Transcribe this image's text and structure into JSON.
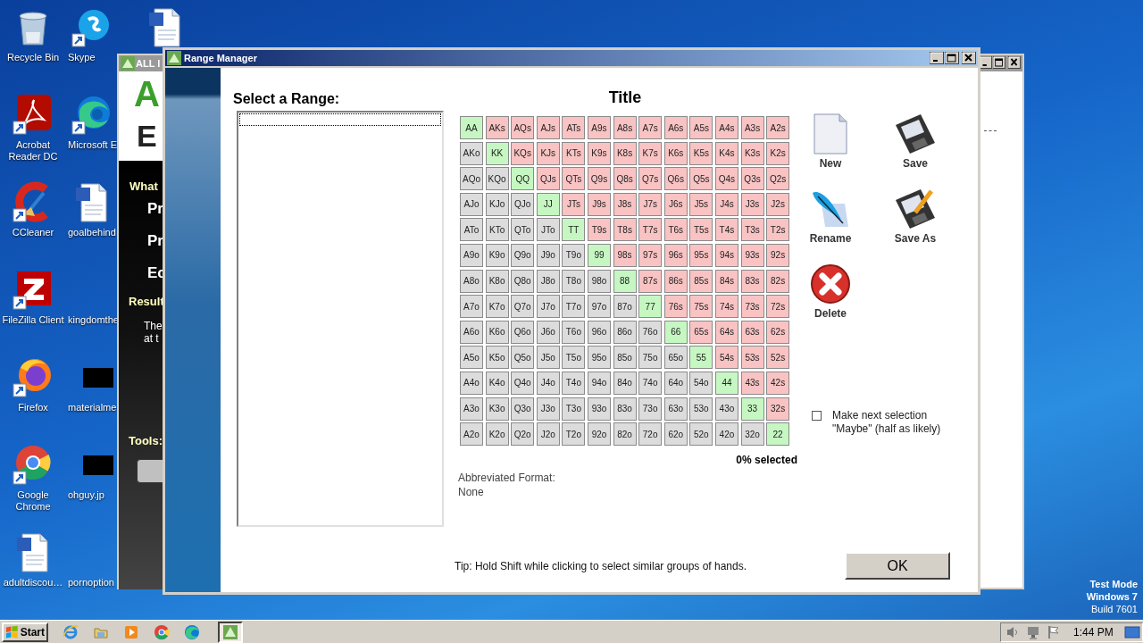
{
  "desktop": {
    "icons": [
      {
        "label": "Recycle Bin",
        "kind": "recycle",
        "shortcut": false
      },
      {
        "label": "Acrobat\nReader DC",
        "kind": "acrobat",
        "shortcut": true
      },
      {
        "label": "CCleaner",
        "kind": "ccleaner",
        "shortcut": true
      },
      {
        "label": "FileZilla Client",
        "kind": "filezilla",
        "shortcut": true
      },
      {
        "label": "Firefox",
        "kind": "firefox",
        "shortcut": true
      },
      {
        "label": "Google\nChrome",
        "kind": "chrome",
        "shortcut": true
      },
      {
        "label": "adultdiscou…",
        "kind": "word",
        "shortcut": false
      },
      {
        "label": "Skype",
        "kind": "skype",
        "shortcut": true
      },
      {
        "label": "Microsoft E",
        "kind": "edge",
        "shortcut": true
      },
      {
        "label": "goalbehind",
        "kind": "word",
        "shortcut": false
      },
      {
        "label": "kingdomthe",
        "kind": "blank",
        "shortcut": false
      },
      {
        "label": "materialme",
        "kind": "redacted",
        "shortcut": false
      },
      {
        "label": "ohguy.jp",
        "kind": "redacted",
        "shortcut": false
      },
      {
        "label": "pornoption",
        "kind": "blank",
        "shortcut": false
      },
      {
        "kind": "word",
        "shortcut": false
      }
    ],
    "os_notice": [
      "Test Mode",
      "Windows 7",
      "Build 7601"
    ]
  },
  "back_window": {
    "title": "ALL I",
    "logo": [
      "A",
      "E"
    ],
    "texts": [
      {
        "text": "What",
        "kind": "heading"
      },
      {
        "text": "Pr",
        "kind": "item"
      },
      {
        "text": "Pr",
        "kind": "item"
      },
      {
        "text": "Ec",
        "kind": "item"
      },
      {
        "text": "Result",
        "kind": "heading"
      },
      {
        "text": "The\nat t",
        "kind": "body"
      },
      {
        "text": "Tools:",
        "kind": "heading"
      }
    ]
  },
  "window": {
    "title": "Range Manager",
    "range_label": "Select a Range:",
    "grid_title": "Title",
    "grid": [
      [
        {
          "label": "AA",
          "kind": "pair"
        },
        {
          "label": "AKs",
          "kind": "suited"
        },
        {
          "label": "AQs",
          "kind": "suited"
        },
        {
          "label": "AJs",
          "kind": "suited"
        },
        {
          "label": "ATs",
          "kind": "suited"
        },
        {
          "label": "A9s",
          "kind": "suited"
        },
        {
          "label": "A8s",
          "kind": "suited"
        },
        {
          "label": "A7s",
          "kind": "suited"
        },
        {
          "label": "A6s",
          "kind": "suited"
        },
        {
          "label": "A5s",
          "kind": "suited"
        },
        {
          "label": "A4s",
          "kind": "suited"
        },
        {
          "label": "A3s",
          "kind": "suited"
        },
        {
          "label": "A2s",
          "kind": "suited"
        }
      ],
      [
        {
          "label": "AKo",
          "kind": "offsuit"
        },
        {
          "label": "KK",
          "kind": "pair"
        },
        {
          "label": "KQs",
          "kind": "suited"
        },
        {
          "label": "KJs",
          "kind": "suited"
        },
        {
          "label": "KTs",
          "kind": "suited"
        },
        {
          "label": "K9s",
          "kind": "suited"
        },
        {
          "label": "K8s",
          "kind": "suited"
        },
        {
          "label": "K7s",
          "kind": "suited"
        },
        {
          "label": "K6s",
          "kind": "suited"
        },
        {
          "label": "K5s",
          "kind": "suited"
        },
        {
          "label": "K4s",
          "kind": "suited"
        },
        {
          "label": "K3s",
          "kind": "suited"
        },
        {
          "label": "K2s",
          "kind": "suited"
        }
      ],
      [
        {
          "label": "AQo",
          "kind": "offsuit"
        },
        {
          "label": "KQo",
          "kind": "offsuit"
        },
        {
          "label": "QQ",
          "kind": "pair"
        },
        {
          "label": "QJs",
          "kind": "suited"
        },
        {
          "label": "QTs",
          "kind": "suited"
        },
        {
          "label": "Q9s",
          "kind": "suited"
        },
        {
          "label": "Q8s",
          "kind": "suited"
        },
        {
          "label": "Q7s",
          "kind": "suited"
        },
        {
          "label": "Q6s",
          "kind": "suited"
        },
        {
          "label": "Q5s",
          "kind": "suited"
        },
        {
          "label": "Q4s",
          "kind": "suited"
        },
        {
          "label": "Q3s",
          "kind": "suited"
        },
        {
          "label": "Q2s",
          "kind": "suited"
        }
      ],
      [
        {
          "label": "AJo",
          "kind": "offsuit"
        },
        {
          "label": "KJo",
          "kind": "offsuit"
        },
        {
          "label": "QJo",
          "kind": "offsuit"
        },
        {
          "label": "JJ",
          "kind": "pair"
        },
        {
          "label": "JTs",
          "kind": "suited"
        },
        {
          "label": "J9s",
          "kind": "suited"
        },
        {
          "label": "J8s",
          "kind": "suited"
        },
        {
          "label": "J7s",
          "kind": "suited"
        },
        {
          "label": "J6s",
          "kind": "suited"
        },
        {
          "label": "J5s",
          "kind": "suited"
        },
        {
          "label": "J4s",
          "kind": "suited"
        },
        {
          "label": "J3s",
          "kind": "suited"
        },
        {
          "label": "J2s",
          "kind": "suited"
        }
      ],
      [
        {
          "label": "ATo",
          "kind": "offsuit"
        },
        {
          "label": "KTo",
          "kind": "offsuit"
        },
        {
          "label": "QTo",
          "kind": "offsuit"
        },
        {
          "label": "JTo",
          "kind": "offsuit"
        },
        {
          "label": "TT",
          "kind": "pair"
        },
        {
          "label": "T9s",
          "kind": "suited"
        },
        {
          "label": "T8s",
          "kind": "suited"
        },
        {
          "label": "T7s",
          "kind": "suited"
        },
        {
          "label": "T6s",
          "kind": "suited"
        },
        {
          "label": "T5s",
          "kind": "suited"
        },
        {
          "label": "T4s",
          "kind": "suited"
        },
        {
          "label": "T3s",
          "kind": "suited"
        },
        {
          "label": "T2s",
          "kind": "suited"
        }
      ],
      [
        {
          "label": "A9o",
          "kind": "offsuit"
        },
        {
          "label": "K9o",
          "kind": "offsuit"
        },
        {
          "label": "Q9o",
          "kind": "offsuit"
        },
        {
          "label": "J9o",
          "kind": "offsuit"
        },
        {
          "label": "T9o",
          "kind": "offsuit"
        },
        {
          "label": "99",
          "kind": "pair"
        },
        {
          "label": "98s",
          "kind": "suited"
        },
        {
          "label": "97s",
          "kind": "suited"
        },
        {
          "label": "96s",
          "kind": "suited"
        },
        {
          "label": "95s",
          "kind": "suited"
        },
        {
          "label": "94s",
          "kind": "suited"
        },
        {
          "label": "93s",
          "kind": "suited"
        },
        {
          "label": "92s",
          "kind": "suited"
        }
      ],
      [
        {
          "label": "A8o",
          "kind": "offsuit"
        },
        {
          "label": "K8o",
          "kind": "offsuit"
        },
        {
          "label": "Q8o",
          "kind": "offsuit"
        },
        {
          "label": "J8o",
          "kind": "offsuit"
        },
        {
          "label": "T8o",
          "kind": "offsuit"
        },
        {
          "label": "98o",
          "kind": "offsuit"
        },
        {
          "label": "88",
          "kind": "pair"
        },
        {
          "label": "87s",
          "kind": "suited"
        },
        {
          "label": "86s",
          "kind": "suited"
        },
        {
          "label": "85s",
          "kind": "suited"
        },
        {
          "label": "84s",
          "kind": "suited"
        },
        {
          "label": "83s",
          "kind": "suited"
        },
        {
          "label": "82s",
          "kind": "suited"
        }
      ],
      [
        {
          "label": "A7o",
          "kind": "offsuit"
        },
        {
          "label": "K7o",
          "kind": "offsuit"
        },
        {
          "label": "Q7o",
          "kind": "offsuit"
        },
        {
          "label": "J7o",
          "kind": "offsuit"
        },
        {
          "label": "T7o",
          "kind": "offsuit"
        },
        {
          "label": "97o",
          "kind": "offsuit"
        },
        {
          "label": "87o",
          "kind": "offsuit"
        },
        {
          "label": "77",
          "kind": "pair"
        },
        {
          "label": "76s",
          "kind": "suited"
        },
        {
          "label": "75s",
          "kind": "suited"
        },
        {
          "label": "74s",
          "kind": "suited"
        },
        {
          "label": "73s",
          "kind": "suited"
        },
        {
          "label": "72s",
          "kind": "suited"
        }
      ],
      [
        {
          "label": "A6o",
          "kind": "offsuit"
        },
        {
          "label": "K6o",
          "kind": "offsuit"
        },
        {
          "label": "Q6o",
          "kind": "offsuit"
        },
        {
          "label": "J6o",
          "kind": "offsuit"
        },
        {
          "label": "T6o",
          "kind": "offsuit"
        },
        {
          "label": "96o",
          "kind": "offsuit"
        },
        {
          "label": "86o",
          "kind": "offsuit"
        },
        {
          "label": "76o",
          "kind": "offsuit"
        },
        {
          "label": "66",
          "kind": "pair"
        },
        {
          "label": "65s",
          "kind": "suited"
        },
        {
          "label": "64s",
          "kind": "suited"
        },
        {
          "label": "63s",
          "kind": "suited"
        },
        {
          "label": "62s",
          "kind": "suited"
        }
      ],
      [
        {
          "label": "A5o",
          "kind": "offsuit"
        },
        {
          "label": "K5o",
          "kind": "offsuit"
        },
        {
          "label": "Q5o",
          "kind": "offsuit"
        },
        {
          "label": "J5o",
          "kind": "offsuit"
        },
        {
          "label": "T5o",
          "kind": "offsuit"
        },
        {
          "label": "95o",
          "kind": "offsuit"
        },
        {
          "label": "85o",
          "kind": "offsuit"
        },
        {
          "label": "75o",
          "kind": "offsuit"
        },
        {
          "label": "65o",
          "kind": "offsuit"
        },
        {
          "label": "55",
          "kind": "pair"
        },
        {
          "label": "54s",
          "kind": "suited"
        },
        {
          "label": "53s",
          "kind": "suited"
        },
        {
          "label": "52s",
          "kind": "suited"
        }
      ],
      [
        {
          "label": "A4o",
          "kind": "offsuit"
        },
        {
          "label": "K4o",
          "kind": "offsuit"
        },
        {
          "label": "Q4o",
          "kind": "offsuit"
        },
        {
          "label": "J4o",
          "kind": "offsuit"
        },
        {
          "label": "T4o",
          "kind": "offsuit"
        },
        {
          "label": "94o",
          "kind": "offsuit"
        },
        {
          "label": "84o",
          "kind": "offsuit"
        },
        {
          "label": "74o",
          "kind": "offsuit"
        },
        {
          "label": "64o",
          "kind": "offsuit"
        },
        {
          "label": "54o",
          "kind": "offsuit"
        },
        {
          "label": "44",
          "kind": "pair"
        },
        {
          "label": "43s",
          "kind": "suited"
        },
        {
          "label": "42s",
          "kind": "suited"
        }
      ],
      [
        {
          "label": "A3o",
          "kind": "offsuit"
        },
        {
          "label": "K3o",
          "kind": "offsuit"
        },
        {
          "label": "Q3o",
          "kind": "offsuit"
        },
        {
          "label": "J3o",
          "kind": "offsuit"
        },
        {
          "label": "T3o",
          "kind": "offsuit"
        },
        {
          "label": "93o",
          "kind": "offsuit"
        },
        {
          "label": "83o",
          "kind": "offsuit"
        },
        {
          "label": "73o",
          "kind": "offsuit"
        },
        {
          "label": "63o",
          "kind": "offsuit"
        },
        {
          "label": "53o",
          "kind": "offsuit"
        },
        {
          "label": "43o",
          "kind": "offsuit"
        },
        {
          "label": "33",
          "kind": "pair"
        },
        {
          "label": "32s",
          "kind": "suited"
        }
      ],
      [
        {
          "label": "A2o",
          "kind": "offsuit"
        },
        {
          "label": "K2o",
          "kind": "offsuit"
        },
        {
          "label": "Q2o",
          "kind": "offsuit"
        },
        {
          "label": "J2o",
          "kind": "offsuit"
        },
        {
          "label": "T2o",
          "kind": "offsuit"
        },
        {
          "label": "92o",
          "kind": "offsuit"
        },
        {
          "label": "82o",
          "kind": "offsuit"
        },
        {
          "label": "72o",
          "kind": "offsuit"
        },
        {
          "label": "62o",
          "kind": "offsuit"
        },
        {
          "label": "52o",
          "kind": "offsuit"
        },
        {
          "label": "42o",
          "kind": "offsuit"
        },
        {
          "label": "32o",
          "kind": "offsuit"
        },
        {
          "label": "22",
          "kind": "pair"
        }
      ]
    ],
    "selected_summary": "0% selected",
    "format_label": "Abbreviated Format:",
    "format_value": "None",
    "tools": [
      {
        "label": "New",
        "kind": "new"
      },
      {
        "label": "Save",
        "kind": "save"
      },
      {
        "label": "Rename",
        "kind": "rename"
      },
      {
        "label": "Save As",
        "kind": "saveas"
      },
      {
        "label": "Delete",
        "kind": "delete"
      }
    ],
    "maybe": {
      "label": "Make next selection\n\"Maybe\" (half as likely)",
      "checked": false
    },
    "tip": "Tip: Hold Shift while clicking to select similar groups of hands.",
    "ok": "OK"
  },
  "taskbar": {
    "start": "Start",
    "tasks": [
      {
        "kind": "ie",
        "selected": false
      },
      {
        "kind": "folder",
        "selected": false
      },
      {
        "kind": "media",
        "selected": false
      },
      {
        "kind": "chrome",
        "selected": false
      },
      {
        "kind": "edge",
        "selected": false
      },
      {
        "kind": "app",
        "selected": true
      }
    ],
    "tray": [
      {
        "kind": "speaker"
      },
      {
        "kind": "network"
      },
      {
        "kind": "flag"
      }
    ],
    "clock": "1:44 PM"
  }
}
